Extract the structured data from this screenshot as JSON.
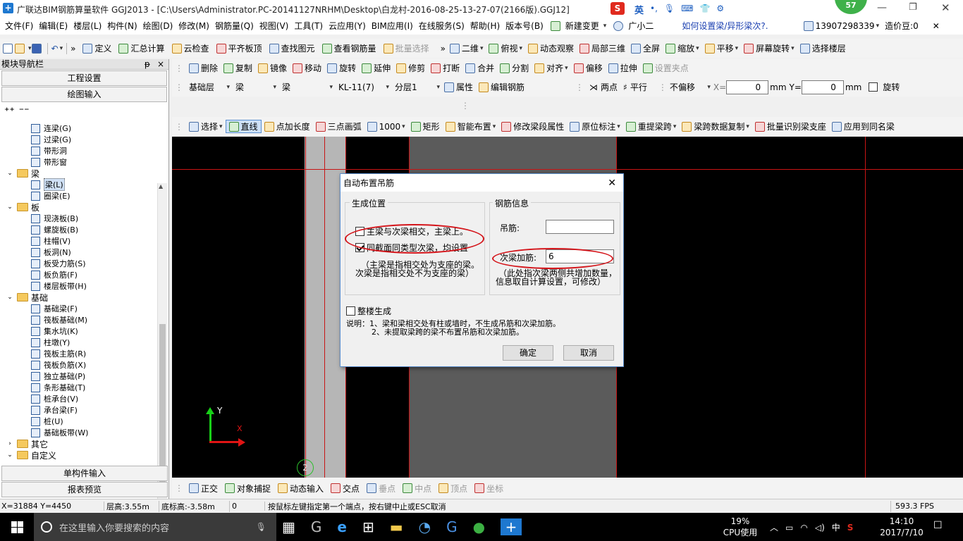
{
  "titlebar": {
    "title": "广联达BIM钢筋算量软件 GGJ2013 - [C:\\Users\\Administrator.PC-20141127NRHM\\Desktop\\白龙村-2016-08-25-13-27-07(2166版).GGJ12]",
    "ime_label": "英",
    "badge": "57"
  },
  "menubar": {
    "items": [
      "文件(F)",
      "编辑(E)",
      "楼层(L)",
      "构件(N)",
      "绘图(D)",
      "修改(M)",
      "钢筋量(Q)",
      "视图(V)",
      "工具(T)",
      "云应用(Y)",
      "BIM应用(I)",
      "在线服务(S)",
      "帮助(H)",
      "版本号(B)"
    ],
    "new_change": "新建变更",
    "assistant": "广小二",
    "help_link": "如何设置梁/异形梁次?.",
    "phone": "13907298339",
    "price": "造价豆:0"
  },
  "toolbar1": {
    "items": [
      "定义",
      "汇总计算",
      "云检查",
      "平齐板顶",
      "查找图元",
      "查看钢筋量",
      "批量选择"
    ],
    "view_items": [
      "二维",
      "俯视",
      "动态观察",
      "局部三维",
      "全屏",
      "缩放",
      "平移",
      "屏幕旋转",
      "选择楼层"
    ]
  },
  "toolbar2": {
    "items": [
      "删除",
      "复制",
      "镜像",
      "移动",
      "旋转",
      "延伸",
      "修剪",
      "打断",
      "合并",
      "分割",
      "对齐",
      "偏移",
      "拉伸",
      "设置夹点"
    ]
  },
  "toolbar3": {
    "layer": "基础层",
    "type1": "梁",
    "type2": "梁",
    "component": "KL-11(7)",
    "sublayer": "分层1",
    "props": "属性",
    "edit_rebar": "编辑钢筋",
    "two_point": "两点",
    "parallel": "平行",
    "offset_mode": "不偏移",
    "x_label": "X=",
    "x_value": "0",
    "y_label": "Y=",
    "y_value": "0",
    "unit": "mm",
    "rotate": "旋转"
  },
  "toolbar4": {
    "items": [
      "选择",
      "直线",
      "点加长度",
      "三点画弧",
      "1000",
      "矩形",
      "智能布置",
      "修改梁段属性",
      "原位标注",
      "重提梁跨",
      "梁跨数据复制",
      "批量识别梁支座",
      "应用到同名梁"
    ]
  },
  "sidebar": {
    "title": "模块导航栏",
    "pin": "ᵽ",
    "close": "×",
    "project_settings": "工程设置",
    "draw_input": "绘图输入",
    "single_input": "单构件输入",
    "report_preview": "报表预览",
    "tree": [
      {
        "level": 2,
        "label": "连梁(G)"
      },
      {
        "level": 2,
        "label": "过梁(G)"
      },
      {
        "level": 2,
        "label": "带形洞"
      },
      {
        "level": 2,
        "label": "带形窗"
      },
      {
        "level": 1,
        "label": "梁"
      },
      {
        "level": 2,
        "label": "梁(L)",
        "selected": true
      },
      {
        "level": 2,
        "label": "圈梁(E)"
      },
      {
        "level": 1,
        "label": "板"
      },
      {
        "level": 2,
        "label": "现浇板(B)"
      },
      {
        "level": 2,
        "label": "螺旋板(B)"
      },
      {
        "level": 2,
        "label": "柱帽(V)"
      },
      {
        "level": 2,
        "label": "板洞(N)"
      },
      {
        "level": 2,
        "label": "板受力筋(S)"
      },
      {
        "level": 2,
        "label": "板负筋(F)"
      },
      {
        "level": 2,
        "label": "楼层板带(H)"
      },
      {
        "level": 1,
        "label": "基础"
      },
      {
        "level": 2,
        "label": "基础梁(F)"
      },
      {
        "level": 2,
        "label": "筏板基础(M)"
      },
      {
        "level": 2,
        "label": "集水坑(K)"
      },
      {
        "level": 2,
        "label": "柱墩(Y)"
      },
      {
        "level": 2,
        "label": "筏板主筋(R)"
      },
      {
        "level": 2,
        "label": "筏板负筋(X)"
      },
      {
        "level": 2,
        "label": "独立基础(P)"
      },
      {
        "level": 2,
        "label": "条形基础(T)"
      },
      {
        "level": 2,
        "label": "桩承台(V)"
      },
      {
        "level": 2,
        "label": "承台梁(F)"
      },
      {
        "level": 2,
        "label": "桩(U)"
      },
      {
        "level": 2,
        "label": "基础板带(W)"
      },
      {
        "level": 1,
        "label": "其它"
      },
      {
        "level": 1,
        "label": "自定义"
      }
    ]
  },
  "canvas": {
    "axis_y": "Y",
    "axis_x": "X",
    "grid_marker": "2"
  },
  "dialog": {
    "title": "自动布置吊筋",
    "group1_label": "生成位置",
    "opt1": "主梁与次梁相交，主梁上。",
    "opt2": "同截面同类型次梁，均设置",
    "note1a": "（主梁是指相交处为支座的梁。",
    "note1b": "次梁是指相交处不为支座的梁）",
    "group2_label": "钢筋信息",
    "hanger_label": "吊筋:",
    "hanger_value": "",
    "extra_label": "次梁加筋:",
    "extra_value": "6",
    "note2a": "（此处指次梁两侧共增加数量，",
    "note2b": "信息取自计算设置，可修改）",
    "whole_building": "整楼生成",
    "desc1": "说明：1、梁和梁相交处有柱或墙时，不生成吊筋和次梁加筋。",
    "desc2": "2、未提取梁跨的梁不布置吊筋和次梁加筋。",
    "ok": "确定",
    "cancel": "取消"
  },
  "snapbar": {
    "items": [
      "正交",
      "对象捕捉",
      "动态输入",
      "交点",
      "垂点",
      "中点",
      "顶点",
      "坐标"
    ]
  },
  "statusbar": {
    "coords": "X=31884 Y=4450",
    "floor_height": "层高:3.55m",
    "base_height": "底标高:-3.58m",
    "zero": "0",
    "hint": "按鼠标左键指定第一个端点，按右键中止或ESC取消",
    "fps": "593.3 FPS"
  },
  "taskbar": {
    "search_placeholder": "在这里输入你要搜索的内容",
    "cpu_percent": "19%",
    "cpu_label": "CPU使用",
    "lang": "中",
    "time": "14:10",
    "date": "2017/7/10"
  },
  "colors": {
    "canvas_bg": "#000000",
    "beam_gray": "#5b5b5b",
    "grid_red": "#c81414",
    "highlight_oval": "#d4141a",
    "accent": "#1e78d0"
  }
}
